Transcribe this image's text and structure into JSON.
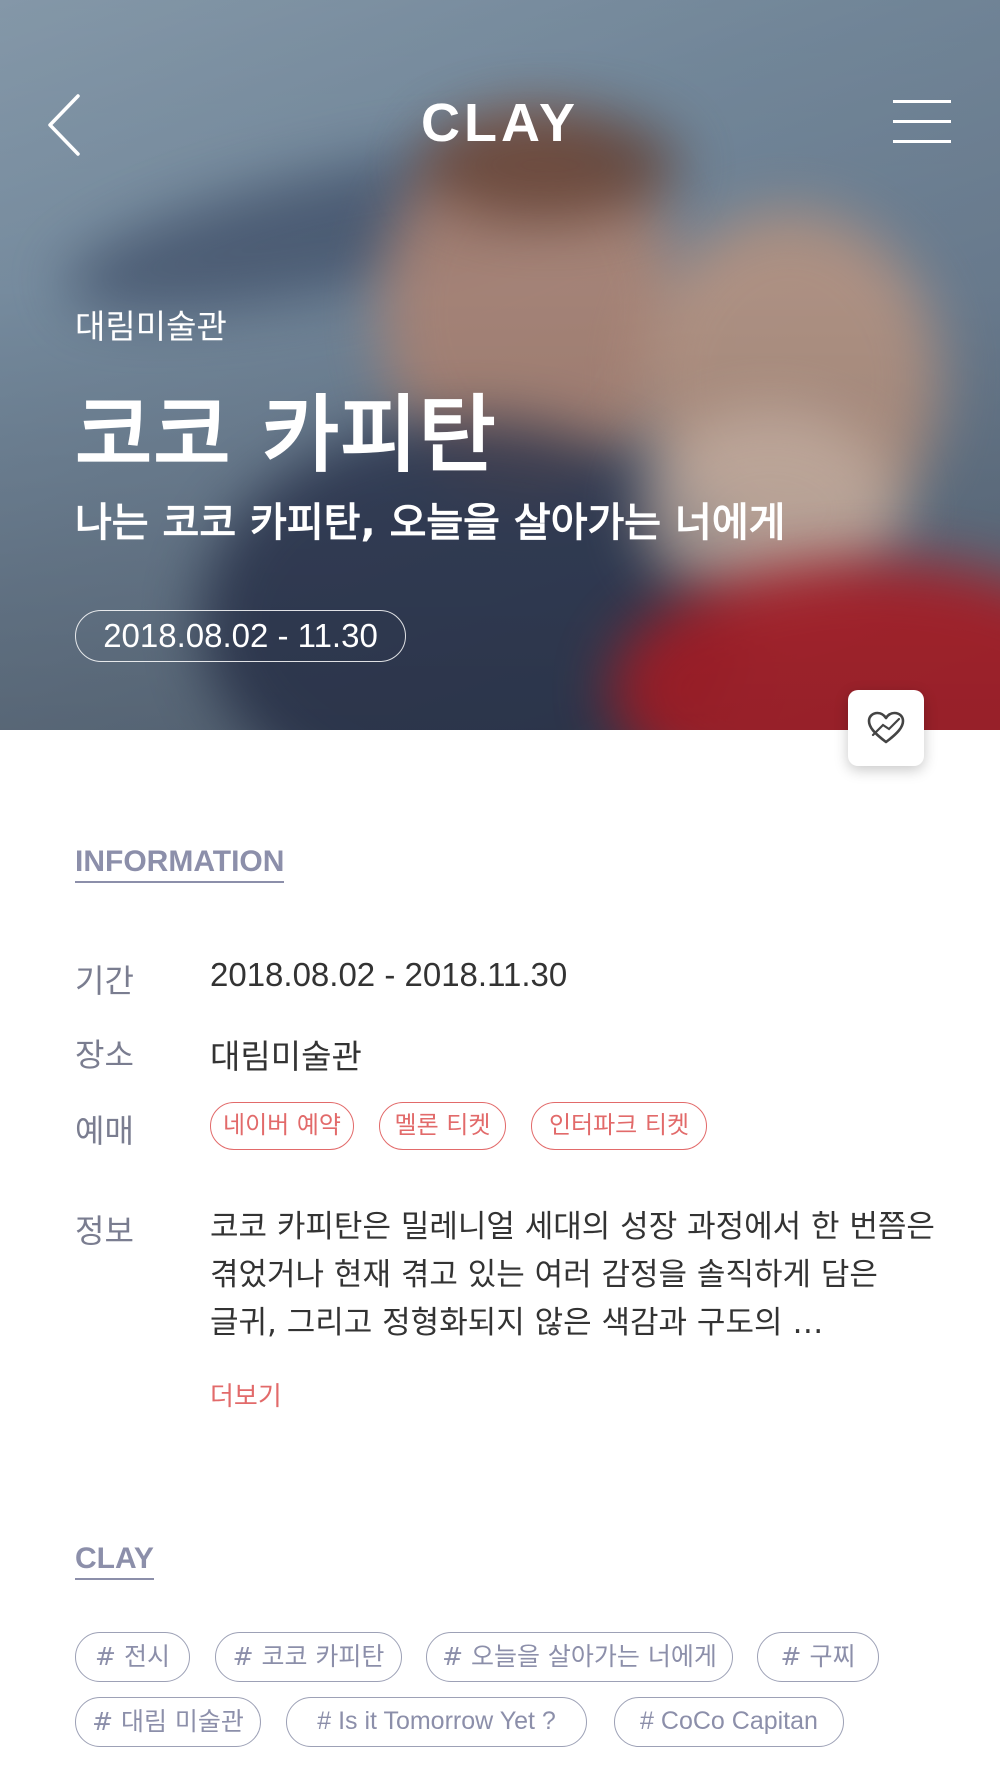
{
  "header": {
    "logo": "CLAY"
  },
  "hero": {
    "venue": "대림미술관",
    "title": "코코 카피탄",
    "subtitle": "나는 코코 카피탄, 오늘을 살아가는 너에게",
    "date_range": "2018.08.02 - 11.30"
  },
  "information": {
    "section_title": "INFORMATION",
    "period_label": "기간",
    "period_value": "2018.08.02 - 2018.11.30",
    "place_label": "장소",
    "place_value": "대림미술관",
    "booking_label": "예매",
    "booking_links": [
      "네이버 예약",
      "멜론 티켓",
      "인터파크 티켓"
    ],
    "info_label": "정보",
    "info_lines": [
      "코코 카피탄은 밀레니얼 세대의 성장 과정에서 한 번쯤은",
      "겪었거나 현재 겪고 있는 여러 감정을 솔직하게 담은",
      "글귀, 그리고 정형화되지 않은 색감과 구도의  …"
    ],
    "more_label": "더보기"
  },
  "clay": {
    "section_title": "CLAY",
    "tags": [
      "# 전시",
      "# 코코 카피탄",
      "# 오늘을 살아가는 너에게",
      "# 구찌",
      "# 대림 미술관",
      "# Is it Tomorrow Yet ?",
      "# CoCo Capitan"
    ]
  },
  "colors": {
    "accent": "#e26a6a",
    "section": "#8c8faa"
  },
  "icons": [
    "back-arrow-icon",
    "hamburger-menu-icon",
    "heart-icon"
  ]
}
